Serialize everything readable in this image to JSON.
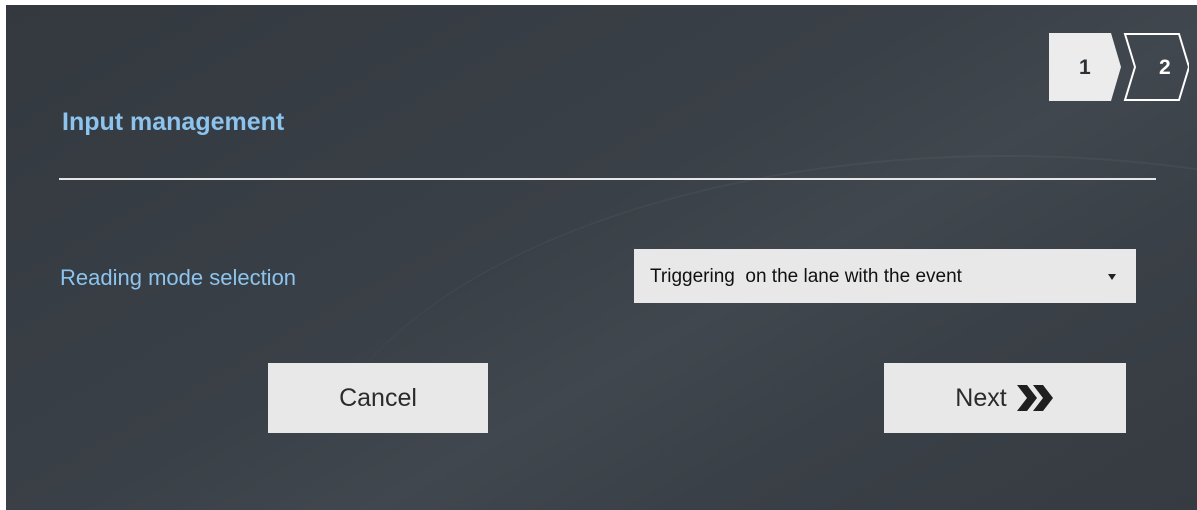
{
  "steps": [
    {
      "label": "1",
      "state": "completed"
    },
    {
      "label": "2",
      "state": "current"
    }
  ],
  "dialog": {
    "title": "Input management"
  },
  "reading_mode": {
    "label": "Reading mode selection",
    "selected": "Triggering  on the lane with the event"
  },
  "buttons": {
    "cancel": "Cancel",
    "next": "Next"
  },
  "icons": {
    "next": "double-chevron-right-icon",
    "dropdown": "caret-down-icon"
  },
  "colors": {
    "accent": "#8cc4ee",
    "background": "#3a4047",
    "button": "#e8e8e8"
  }
}
